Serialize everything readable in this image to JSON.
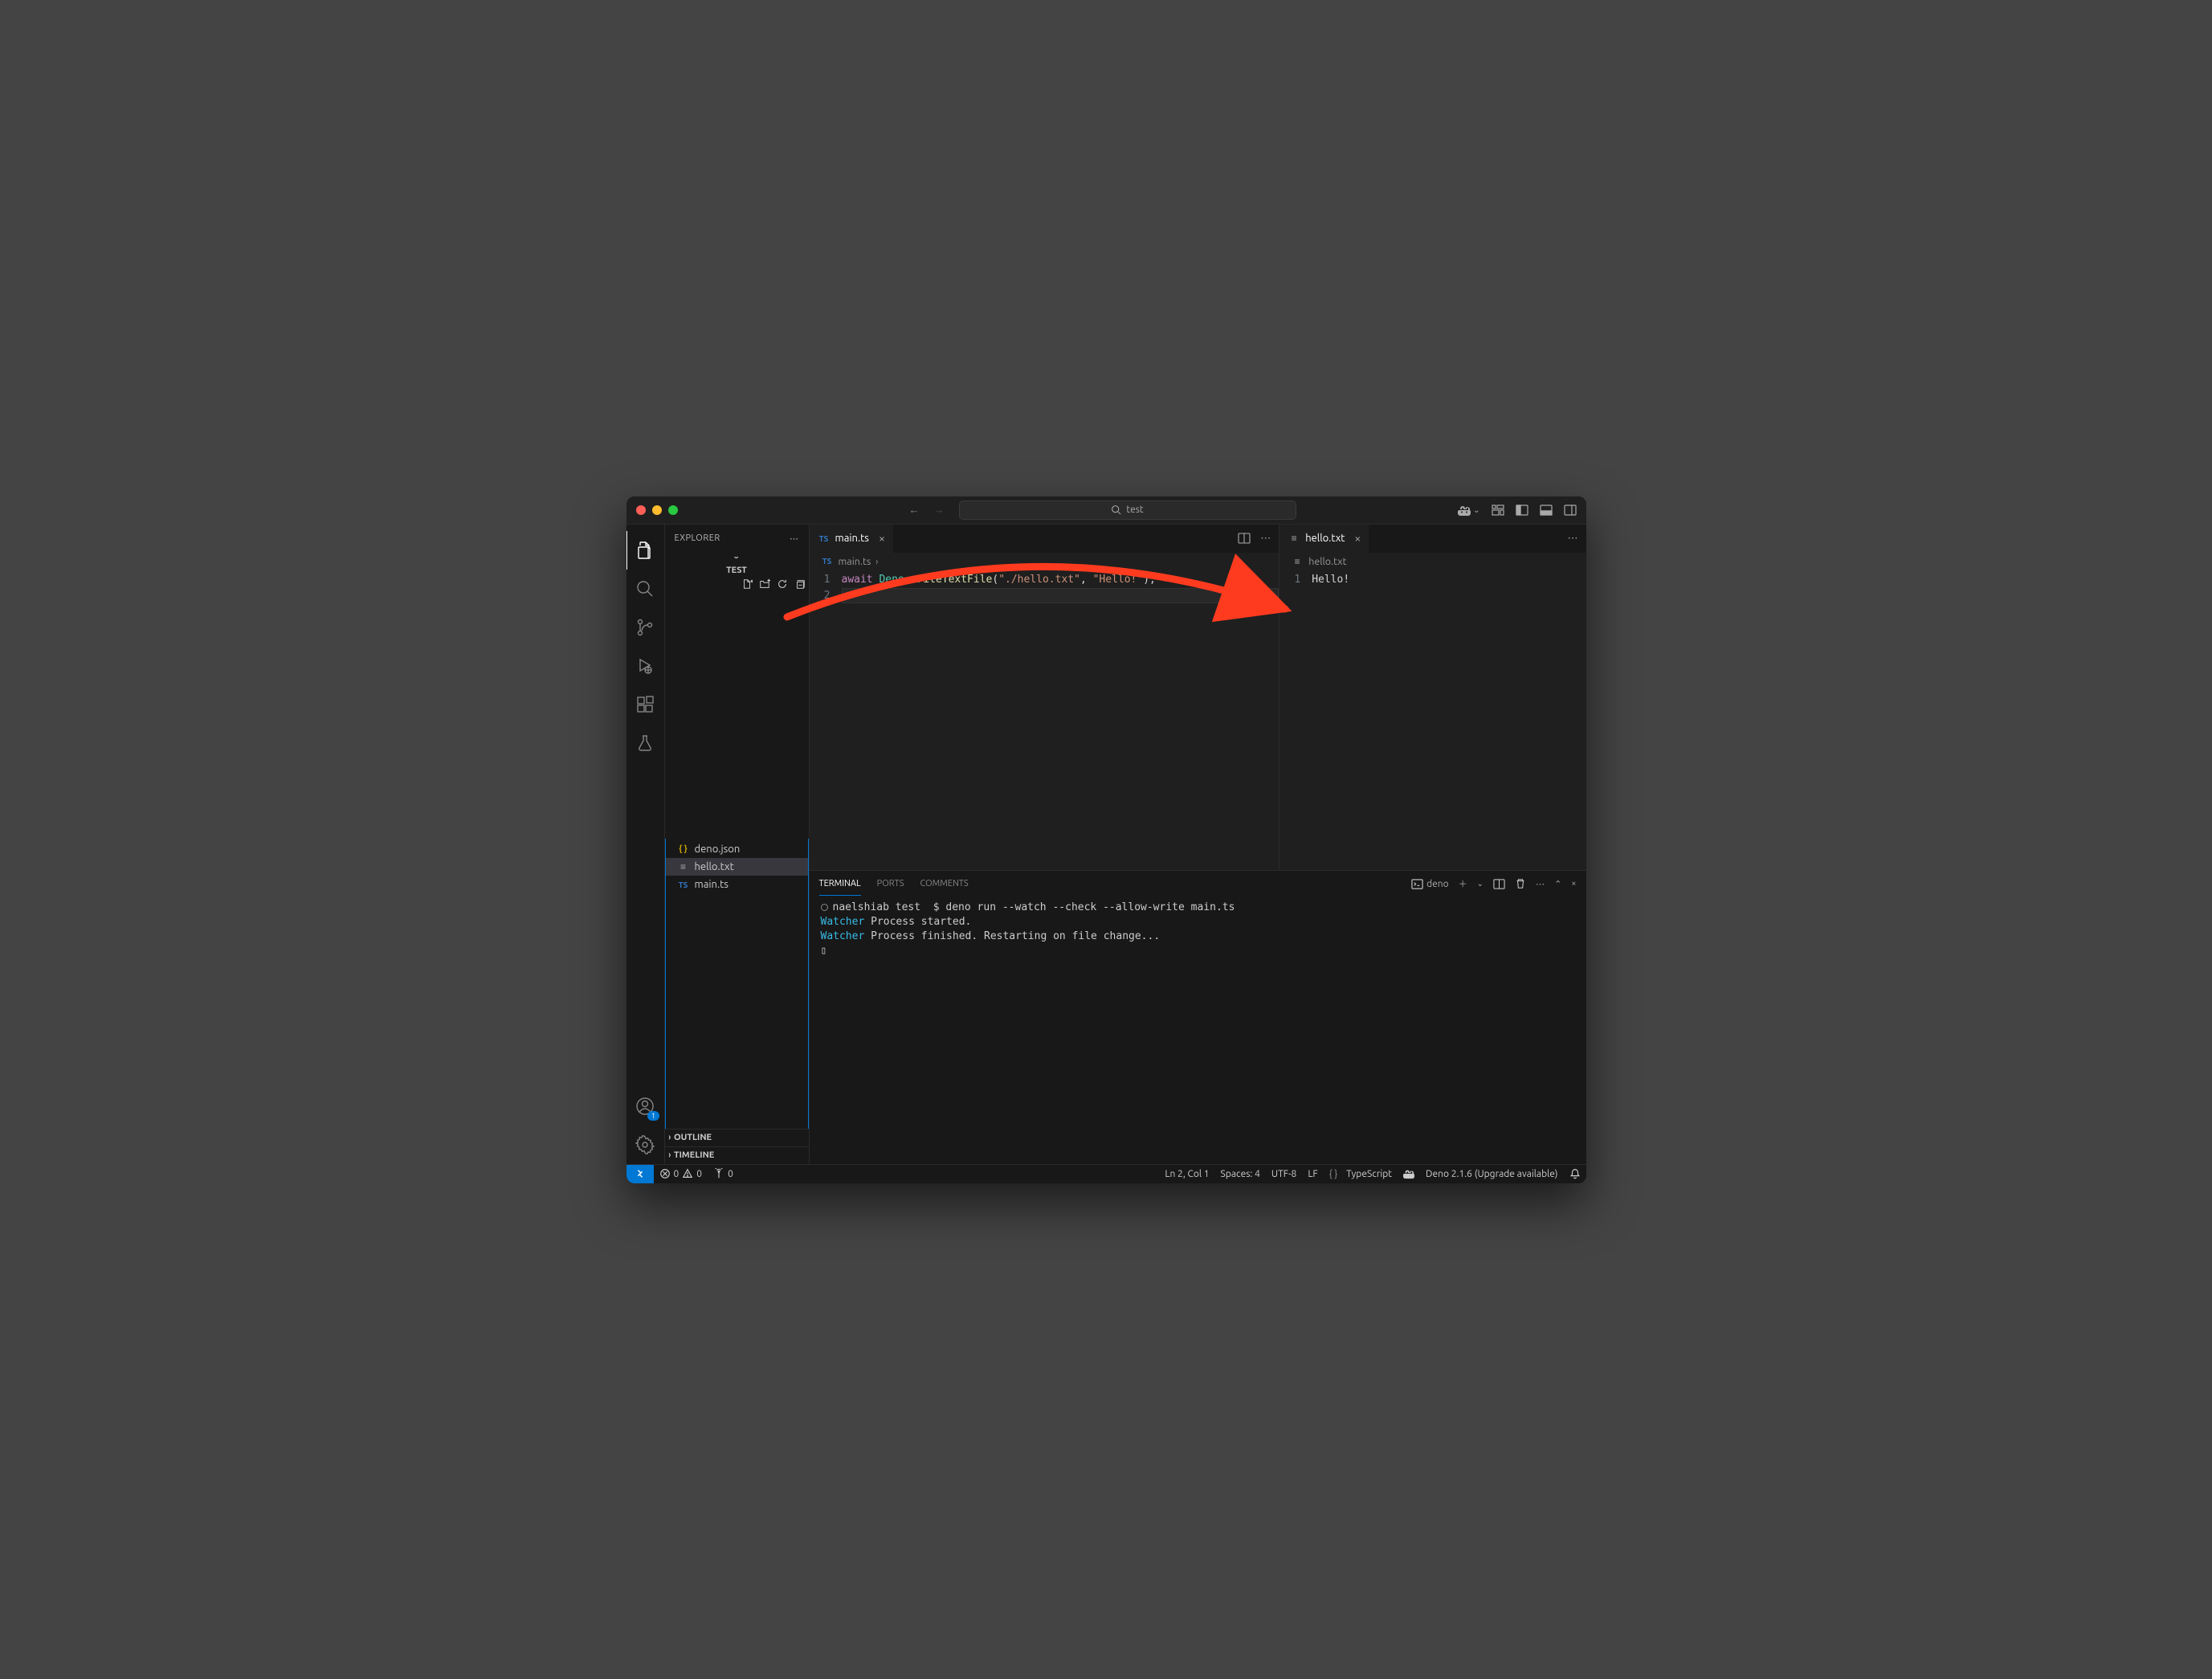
{
  "titlebar": {
    "search_text": "test"
  },
  "sidebar": {
    "title": "EXPLORER",
    "folder": "TEST",
    "files": [
      {
        "icon": "{ }",
        "name": "deno.json",
        "iconClass": "json-i"
      },
      {
        "icon": "≡",
        "name": "hello.txt",
        "iconClass": "txt-i"
      },
      {
        "icon": "TS",
        "name": "main.ts",
        "iconClass": "ts-i"
      }
    ],
    "outline": "OUTLINE",
    "timeline": "TIMELINE"
  },
  "editors": {
    "left": {
      "tab_icon": "TS",
      "tab_name": "main.ts",
      "breadcrumb_icon": "TS",
      "breadcrumb": "main.ts",
      "lines": [
        "1",
        "2"
      ],
      "code": {
        "kw": "await",
        "obj": "Deno",
        "dot": ".",
        "fn": "writeTextFile",
        "open": "(",
        "arg1": "\"./hello.txt\"",
        "comma": ", ",
        "arg2": "\"Hello!\"",
        "close": ");"
      }
    },
    "right": {
      "tab_icon": "≡",
      "tab_name": "hello.txt",
      "breadcrumb_icon": "≡",
      "breadcrumb": "hello.txt",
      "lines": [
        "1"
      ],
      "content": "Hello!"
    }
  },
  "panel": {
    "tabs": {
      "terminal": "TERMINAL",
      "ports": "PORTS",
      "comments": "COMMENTS"
    },
    "task": "deno",
    "terminal": {
      "prompt_user": "naelshiab",
      "prompt_dir": "test",
      "prompt_sym": "$",
      "cmd": "deno run --watch --check --allow-write main.ts",
      "l2a": "Watcher",
      "l2b": " Process started.",
      "l3a": "Watcher",
      "l3b": " Process finished. Restarting on file change...",
      "cursor": "▯"
    }
  },
  "statusbar": {
    "errors": "0",
    "warnings": "0",
    "ports": "0",
    "ln_col": "Ln 2, Col 1",
    "spaces": "Spaces: 4",
    "encoding": "UTF-8",
    "eol": "LF",
    "lang": "TypeScript",
    "deno": "Deno 2.1.6 (Upgrade available)"
  },
  "accounts_badge": "1"
}
